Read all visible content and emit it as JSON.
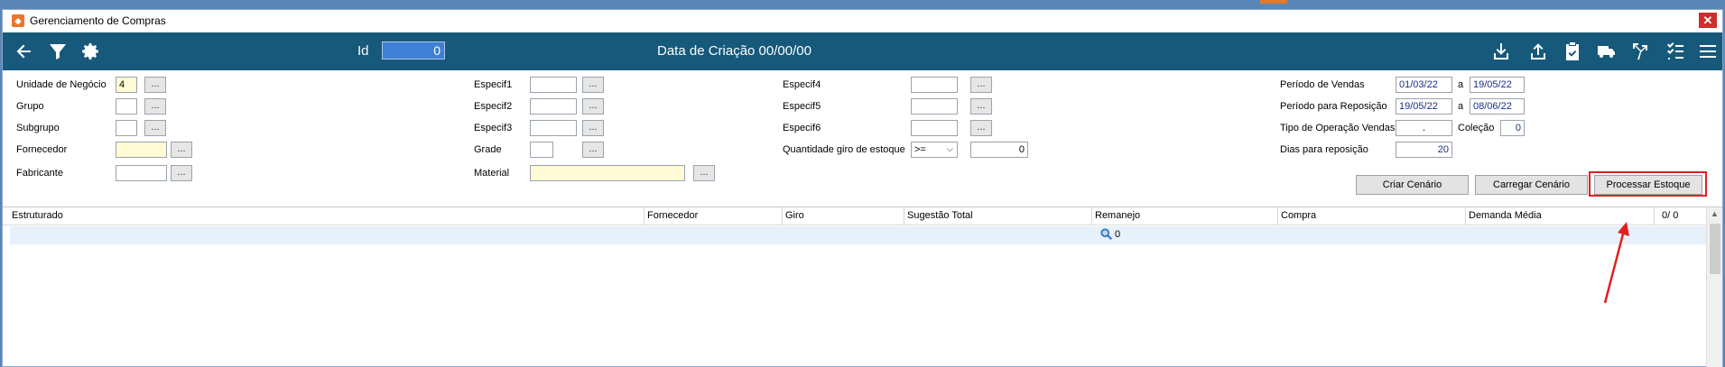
{
  "window": {
    "title": "Gerenciamento de Compras",
    "close_label": "✕"
  },
  "toolbar": {
    "id_label": "Id",
    "id_value": "0",
    "creation_date": "Data de Criação 00/00/00",
    "icons": [
      "back-arrow-icon",
      "filter-icon",
      "gear-icon",
      "download-icon",
      "upload-icon",
      "clipboard-check-icon",
      "truck-icon",
      "merge-arrows-icon",
      "checklist-icon",
      "hamburger-menu-icon"
    ]
  },
  "form": {
    "unidade_label": "Unidade de Negócio",
    "unidade_value": "4",
    "grupo_label": "Grupo",
    "subgrupo_label": "Subgrupo",
    "fornecedor_label": "Fornecedor",
    "fabricante_label": "Fabricante",
    "especif1_label": "Especif1",
    "especif2_label": "Especif2",
    "especif3_label": "Especif3",
    "grade_label": "Grade",
    "material_label": "Material",
    "especif4_label": "Especif4",
    "especif5_label": "Especif5",
    "especif6_label": "Especif6",
    "qtd_giro_label": "Quantidade giro de estoque",
    "qtd_giro_operator": ">=",
    "qtd_giro_value": "0",
    "periodo_vendas_label": "Período de Vendas",
    "periodo_vendas_from": "01/03/22",
    "periodo_vendas_to": "19/05/22",
    "periodo_reposicao_label": "Período para Reposição",
    "periodo_reposicao_from": "19/05/22",
    "periodo_reposicao_to": "08/06/22",
    "a_label": "a",
    "tipo_operacao_label": "Tipo de Operação Vendas",
    "tipo_operacao_value": ".",
    "colecao_label": "Coleção",
    "colecao_value": "0",
    "dias_reposicao_label": "Dias para reposição",
    "dias_reposicao_value": "20",
    "dots_label": "..."
  },
  "actions": {
    "criar": "Criar Cenário",
    "carregar": "Carregar Cenário",
    "processar": "Processar Estoque"
  },
  "grid": {
    "columns": [
      "Estruturado",
      "Fornecedor",
      "Giro",
      "Sugestão Total",
      "Remanejo",
      "Compra",
      "Demanda Média"
    ],
    "counter": "0/  0",
    "search_count": "0"
  },
  "colors": {
    "toolbar_bg": "#16597a",
    "highlight": "#e0201f",
    "row_bg": "#e6f1fb"
  }
}
